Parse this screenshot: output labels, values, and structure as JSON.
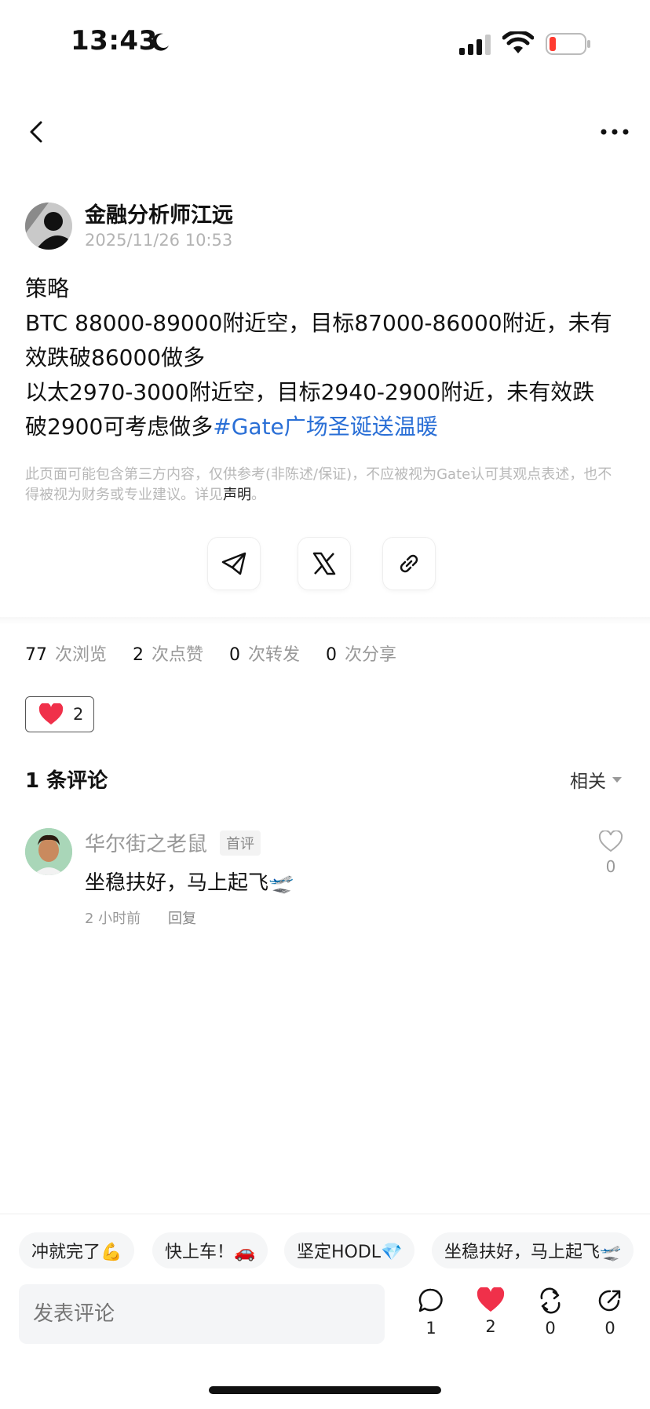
{
  "status_bar": {
    "time": "13:43"
  },
  "author": {
    "name": "金融分析师江远",
    "time": "2025/11/26 10:53"
  },
  "content": {
    "lines": [
      "策略",
      "BTC 88000-89000附近空，目标87000-86000附近，未有",
      "效跌破86000做多",
      "以太2970-3000附近空，目标2940-2900附近，未有效跌"
    ],
    "last_line_text": "破2900可考虑做多",
    "hashtag": "#Gate广场圣诞送温暖"
  },
  "disclaimer": {
    "text": "此页面可能包含第三方内容，仅供参考(非陈述/保证)，不应被视为Gate认可其观点表述，也不得被视为财务或专业建议。详见",
    "link": "声明",
    "end": "。"
  },
  "share": [
    "telegram-icon",
    "x-icon",
    "link-icon"
  ],
  "stats": [
    {
      "num": "77",
      "label": "次浏览"
    },
    {
      "num": "2",
      "label": "次点赞"
    },
    {
      "num": "0",
      "label": "次转发"
    },
    {
      "num": "0",
      "label": "次分享"
    }
  ],
  "like_pill": {
    "count": "2"
  },
  "comments_header": {
    "title": "1 条评论",
    "sort": "相关"
  },
  "comment": {
    "name": "华尔街之老鼠",
    "badge": "首评",
    "text": "坐稳扶好，马上起飞🛫",
    "time": "2 小时前",
    "reply": "回复",
    "likes": "0"
  },
  "quick_replies": [
    "冲就完了💪",
    "快上车！🚗",
    "坚定HODL💎",
    "坐稳扶好，马上起飞🛫"
  ],
  "input": {
    "placeholder": "发表评论"
  },
  "actions": [
    {
      "icon": "comment-icon",
      "count": "1"
    },
    {
      "icon": "heart-icon",
      "count": "2"
    },
    {
      "icon": "repost-icon",
      "count": "0"
    },
    {
      "icon": "share-icon",
      "count": "0"
    }
  ],
  "colors": {
    "link": "#2a6fd6",
    "heart": "#f0304a"
  }
}
